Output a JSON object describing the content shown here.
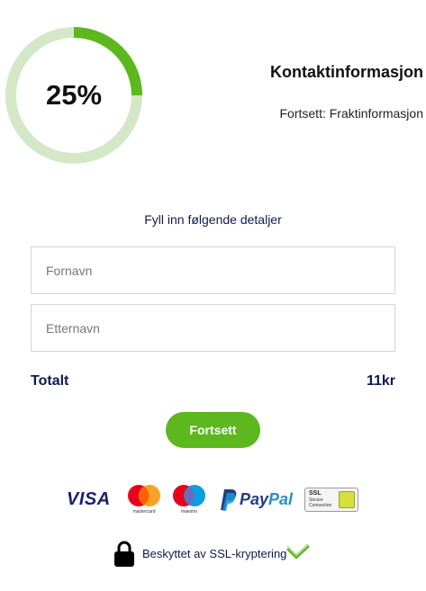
{
  "progress": {
    "percent": 25,
    "label": "25%",
    "ring_color": "#5cb81e",
    "track_color": "#d4e8c8"
  },
  "steps": {
    "current": "Kontaktinformasjon",
    "next": "Fortsett: Fraktinformasjon"
  },
  "form": {
    "instruction": "Fyll inn følgende detaljer",
    "first_name_placeholder": "Fornavn",
    "last_name_placeholder": "Etternavn"
  },
  "total": {
    "label": "Totalt",
    "value": "11kr"
  },
  "continue_button": {
    "label": "Fortsett",
    "color": "#5cb81e"
  },
  "payment_methods": {
    "visa": "VISA",
    "mastercard": "mastercard",
    "maestro": "maestro",
    "paypal_pay": "Pay",
    "paypal_pal": "Pal",
    "ssl_title": "SSL",
    "ssl_subtitle": "Secure Connection"
  },
  "security": {
    "text": "Beskyttet av SSL-kryptering",
    "icons": [
      "padlock-icon",
      "checkmark-icon"
    ]
  }
}
